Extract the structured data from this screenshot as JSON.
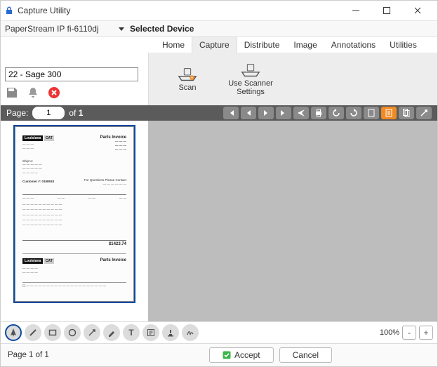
{
  "window": {
    "title": "Capture Utility"
  },
  "device": {
    "name": "PaperStream IP fi-6110dj",
    "selected_label": "Selected Device"
  },
  "tabs": [
    "Home",
    "Capture",
    "Distribute",
    "Image",
    "Annotations",
    "Utilities"
  ],
  "tabs_active_index": 1,
  "ribbon": {
    "scan": "Scan",
    "use_scanner_settings_l1": "Use Scanner",
    "use_scanner_settings_l2": "Settings"
  },
  "doc_input": "22 - Sage 300",
  "page_bar": {
    "label": "Page:",
    "current": "1",
    "of": "of",
    "total": "1"
  },
  "zoom": {
    "value": "100%"
  },
  "buttons": {
    "accept": "Accept",
    "cancel": "Cancel"
  },
  "status": {
    "page_info": "Page 1 of 1"
  },
  "thumb": {
    "logo": "Louisiana",
    "brand": "CAT",
    "title": "Parts Invoice",
    "customer_line": "Customer #: 0198918",
    "total_label": "$1423.74"
  }
}
